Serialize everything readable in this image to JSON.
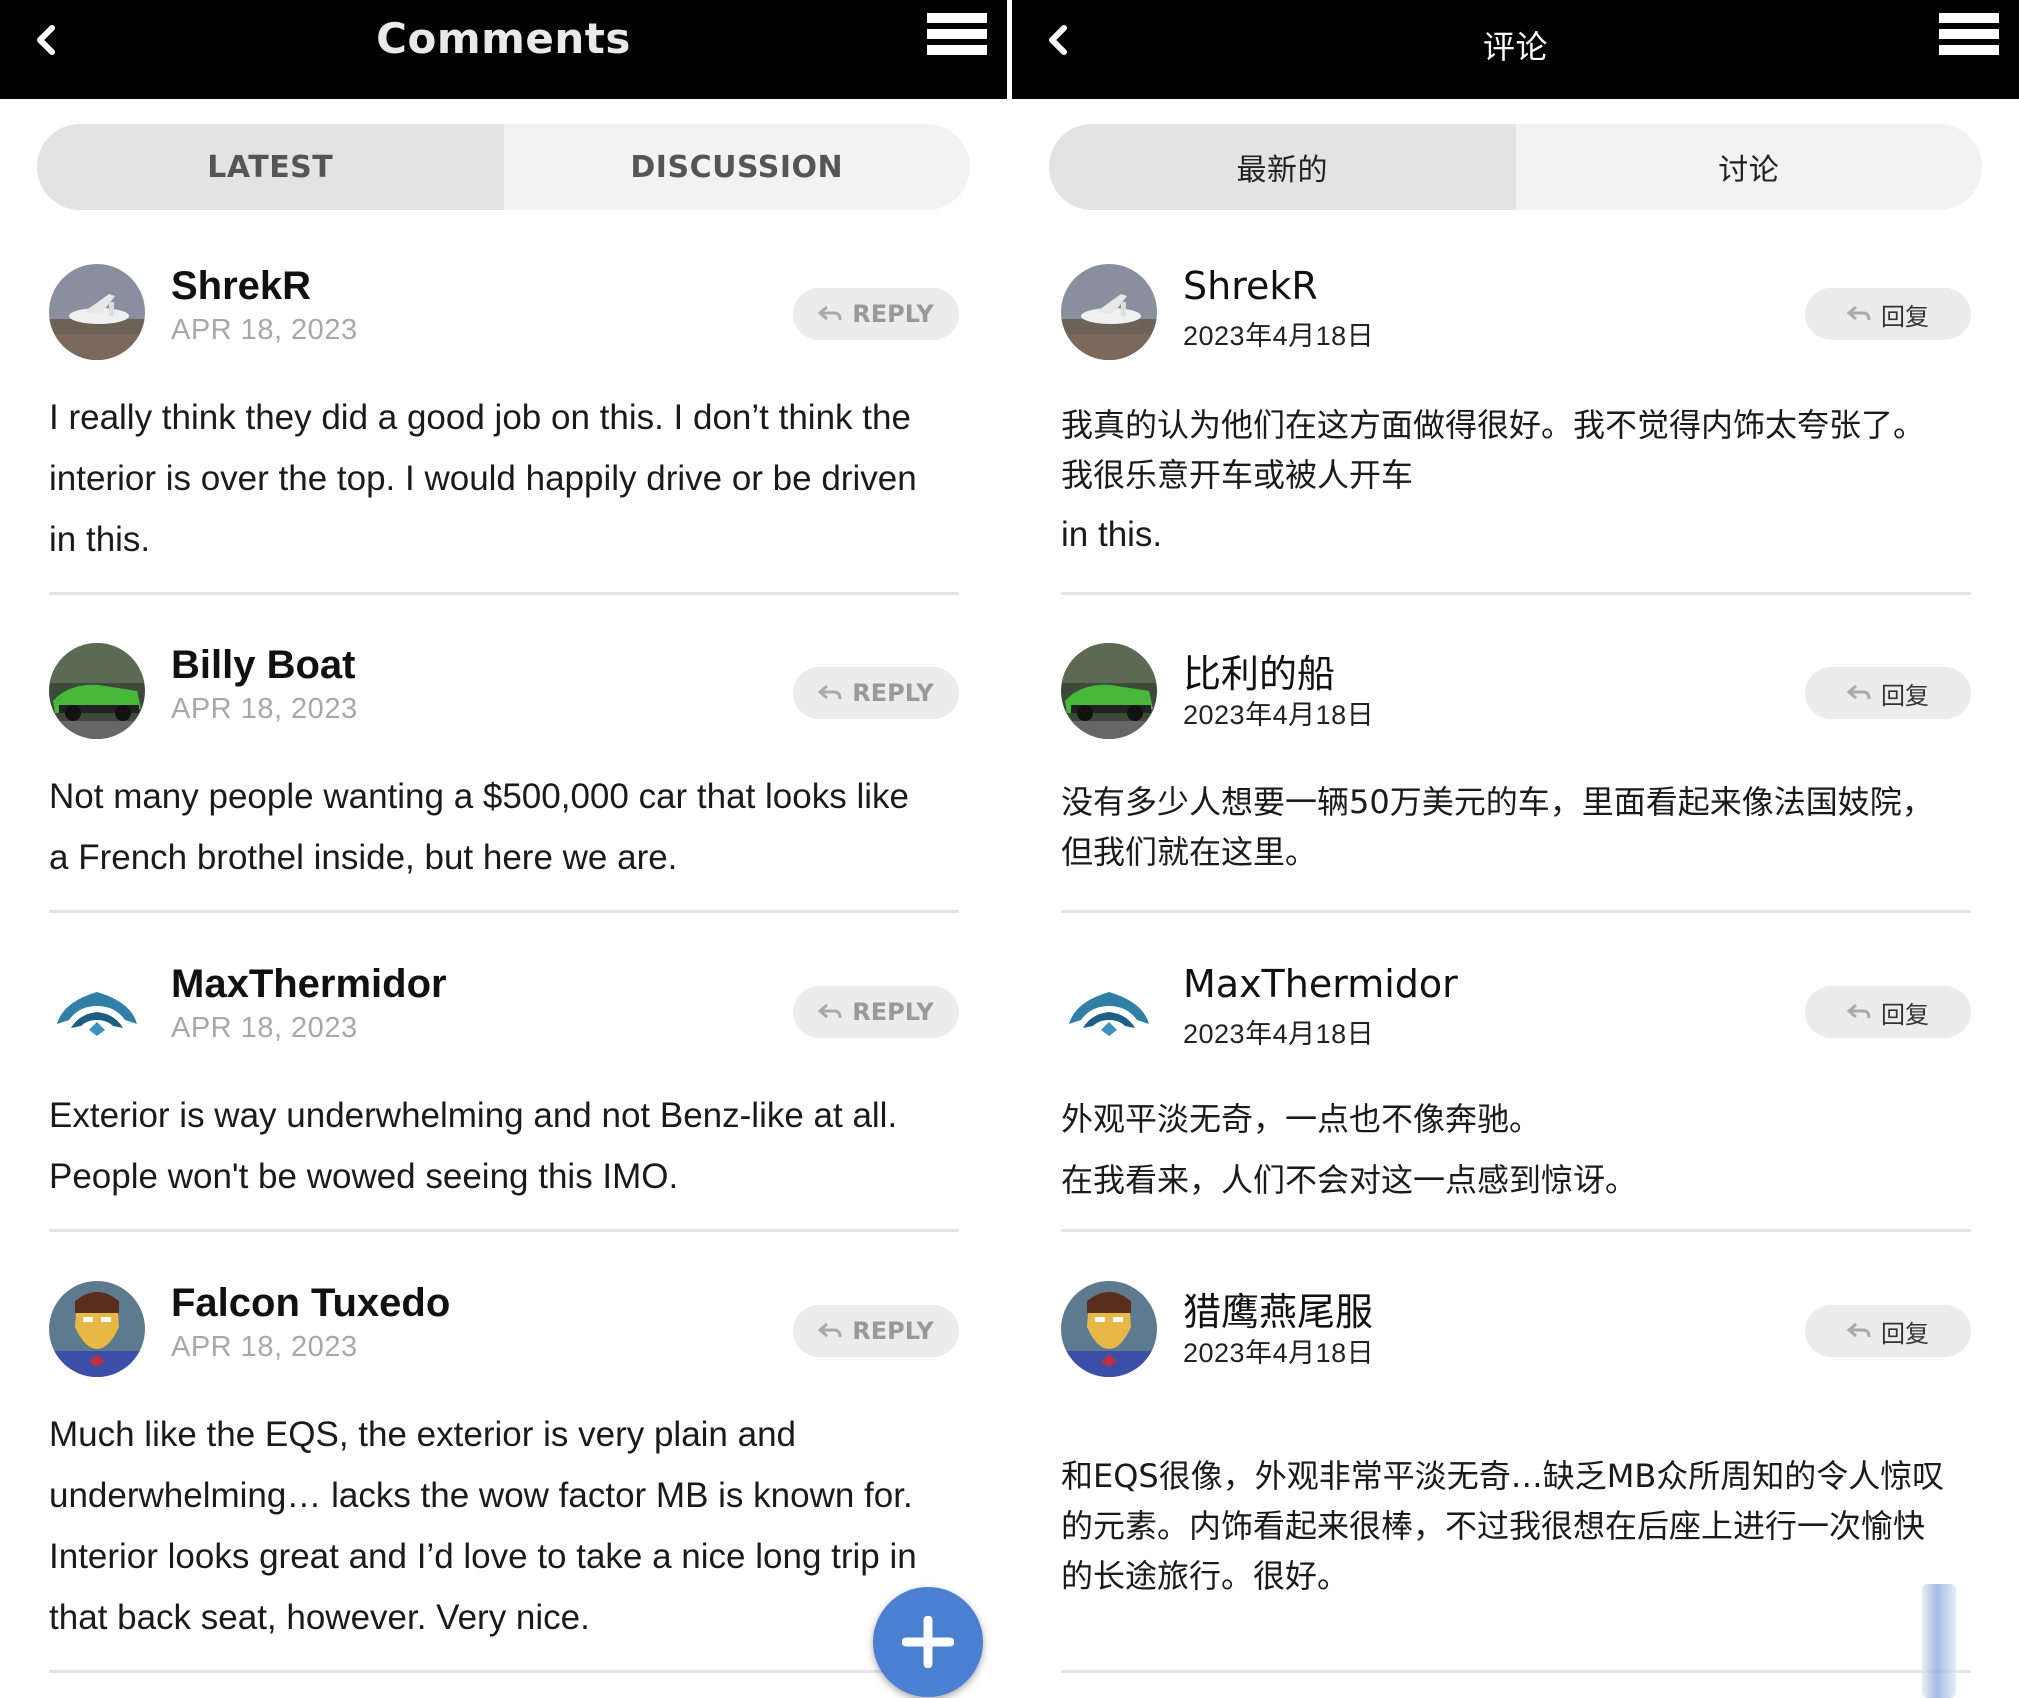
{
  "left": {
    "header": {
      "title": "Comments"
    },
    "tabs": [
      {
        "label": "LATEST"
      },
      {
        "label": "DISCUSSION"
      }
    ],
    "reply_label": "REPLY",
    "comments": [
      {
        "user": "ShrekR",
        "date": "APR 18, 2023",
        "lines": [
          "I really think they did a good job on this. I don’t think the",
          "interior is over the top. I would happily drive or be driven",
          "in this."
        ]
      },
      {
        "user": "Billy Boat",
        "date": "APR 18, 2023",
        "lines": [
          "Not many people wanting a $500,000 car that looks like",
          "a French brothel inside, but here we are."
        ]
      },
      {
        "user": "MaxThermidor",
        "date": "APR 18, 2023",
        "lines": [
          "Exterior is way underwhelming and not Benz-like at all.",
          "People won't be wowed seeing this IMO."
        ]
      },
      {
        "user": "Falcon Tuxedo",
        "date": "APR 18, 2023",
        "lines": [
          "Much like the EQS, the exterior is very plain and",
          "underwhelming… lacks the wow factor MB is known for.",
          "Interior looks great and I’d love to take a nice long trip in",
          "that back seat, however. Very nice."
        ]
      }
    ]
  },
  "right": {
    "header": {
      "title": "评论"
    },
    "tabs": [
      {
        "label": "最新的"
      },
      {
        "label": "讨论"
      }
    ],
    "reply_label": "回复",
    "comments": [
      {
        "user": "ShrekR",
        "date": "2023年4月18日",
        "lines": [
          "我真的认为他们在这方面做得很好。我不觉得内饰太夸张了。",
          "我很乐意开车或被人开车",
          "in this."
        ]
      },
      {
        "user": "比利的船",
        "date": "2023年4月18日",
        "lines": [
          "没有多少人想要一辆50万美元的车，里面看起来像法国妓院，",
          "但我们就在这里。"
        ]
      },
      {
        "user": "MaxThermidor",
        "date": "2023年4月18日",
        "lines": [
          "外观平淡无奇，一点也不像奔驰。",
          "在我看来，人们不会对这一点感到惊讶。"
        ]
      },
      {
        "user": "猎鹰燕尾服",
        "date": "2023年4月18日",
        "lines": [
          "和EQS很像，外观非常平淡无奇…缺乏MB众所周知的令人惊叹",
          "的元素。内饰看起来很棒，不过我很想在后座上进行一次愉快",
          "的长途旅行。很好。"
        ]
      }
    ]
  },
  "icons": {
    "back": "chevron-left-icon",
    "menu": "hamburger-menu-icon",
    "reply": "reply-arrow-icon",
    "add": "plus-icon"
  },
  "colors": {
    "header_bg": "#000000",
    "fab": "#4b7fd1",
    "tab_active": "#e3e3e3",
    "tab_inactive": "#f2f2f2"
  }
}
